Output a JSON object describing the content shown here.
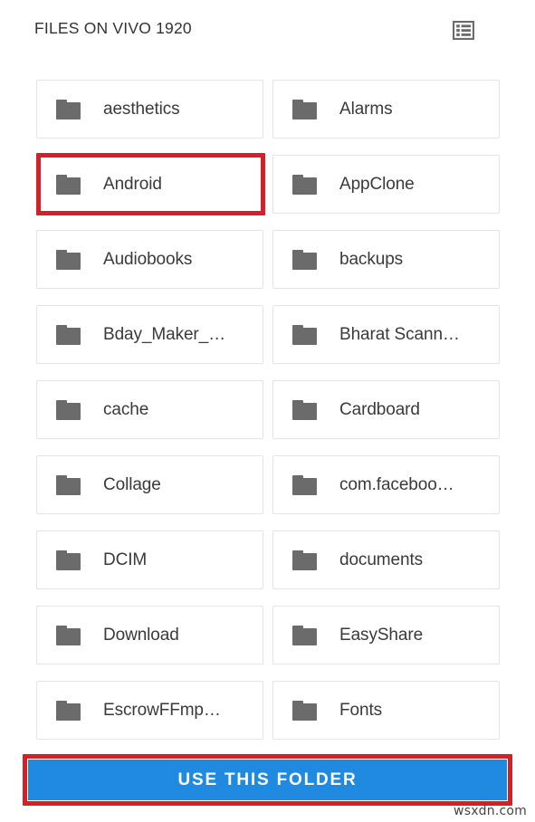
{
  "header": {
    "title": "FILES ON VIVO 1920",
    "view_toggle_icon": "list-view-icon"
  },
  "folders": [
    {
      "name": "aesthetics",
      "icon": "folder-icon",
      "highlighted": false
    },
    {
      "name": "Alarms",
      "icon": "folder-icon",
      "highlighted": false
    },
    {
      "name": "Android",
      "icon": "folder-icon",
      "highlighted": true
    },
    {
      "name": "AppClone",
      "icon": "folder-icon",
      "highlighted": false
    },
    {
      "name": "Audiobooks",
      "icon": "folder-icon",
      "highlighted": false
    },
    {
      "name": "backups",
      "icon": "folder-icon",
      "highlighted": false
    },
    {
      "name": "Bday_Maker_…",
      "icon": "folder-icon",
      "highlighted": false
    },
    {
      "name": "Bharat Scann…",
      "icon": "folder-icon",
      "highlighted": false
    },
    {
      "name": "cache",
      "icon": "folder-icon",
      "highlighted": false
    },
    {
      "name": "Cardboard",
      "icon": "folder-icon",
      "highlighted": false
    },
    {
      "name": "Collage",
      "icon": "folder-icon",
      "highlighted": false
    },
    {
      "name": "com.faceboo…",
      "icon": "folder-icon",
      "highlighted": false
    },
    {
      "name": "DCIM",
      "icon": "folder-icon",
      "highlighted": false
    },
    {
      "name": "documents",
      "icon": "folder-icon",
      "highlighted": false
    },
    {
      "name": "Download",
      "icon": "folder-icon",
      "highlighted": false
    },
    {
      "name": "EasyShare",
      "icon": "folder-icon",
      "highlighted": false
    },
    {
      "name": "EscrowFFmp…",
      "icon": "folder-icon",
      "highlighted": false
    },
    {
      "name": "Fonts",
      "icon": "folder-icon",
      "highlighted": false
    }
  ],
  "footer": {
    "use_folder_label": "USE THIS FOLDER"
  },
  "watermark": "wsxdn.com",
  "colors": {
    "accent_blue": "#2089e0",
    "annotation_red": "#d32029",
    "folder_gray": "#6b6b6b",
    "card_border": "#e4e4e4",
    "text_dark": "#3a3a3a"
  }
}
